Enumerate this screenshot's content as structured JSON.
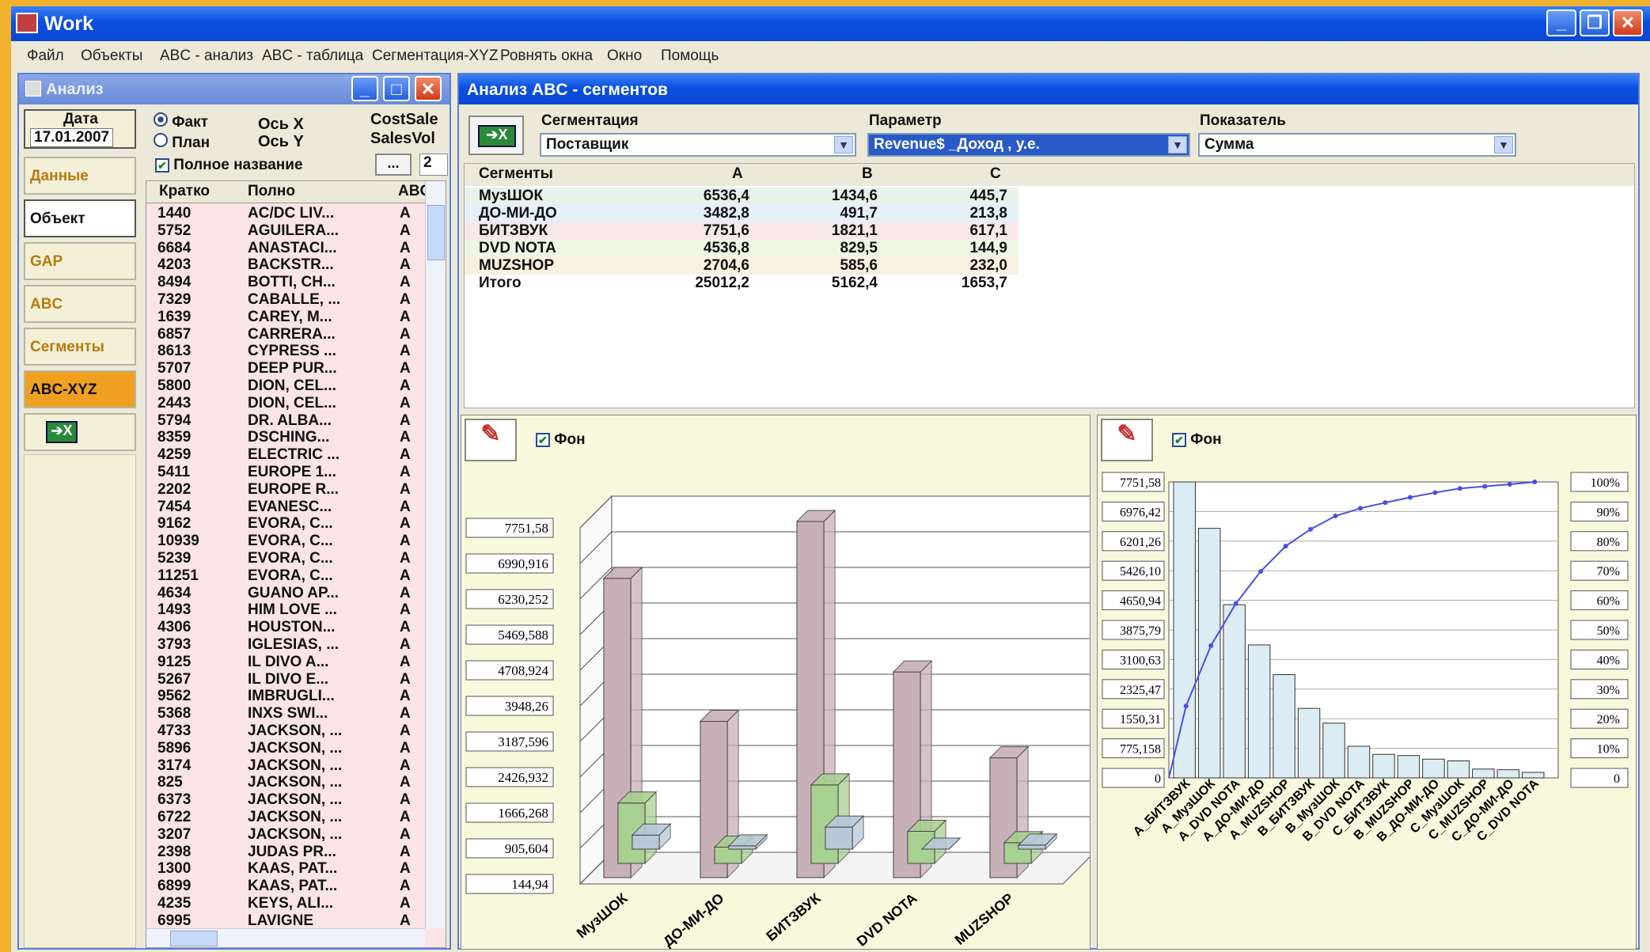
{
  "window": {
    "title": "Work"
  },
  "menu": [
    "Файл",
    "Объекты",
    "ABC - анализ",
    "ABC - таблица",
    "Сегментация-XYZ",
    "Ровнять окна",
    "Окно",
    "Помощь"
  ],
  "left_panel": {
    "title": "Анализ",
    "date_label": "Дата",
    "date_value": "17.01.2007",
    "radio_fact": "Факт",
    "radio_plan": "План",
    "axis_x": "Ось X",
    "axis_y": "Ось Y",
    "full_name": "Полное название",
    "cost_label": "CostSale",
    "sales_label": "SalesVol",
    "ellipsis": "...",
    "num_value": "2",
    "side_buttons": [
      "Данные",
      "Объект",
      "GAP",
      "ABC",
      "Сегменты",
      "ABC-XYZ"
    ],
    "columns": [
      "Кратко",
      "Полно",
      "ABC"
    ],
    "rows": [
      [
        "1440",
        "AC/DC LIV...",
        "A"
      ],
      [
        "5752",
        "AGUILERA...",
        "A"
      ],
      [
        "6684",
        "ANASTACI...",
        "A"
      ],
      [
        "4203",
        "BACKSTR...",
        "A"
      ],
      [
        "8494",
        "BOTTI, CH...",
        "A"
      ],
      [
        "7329",
        "CABALLE, ...",
        "A"
      ],
      [
        "1639",
        "CAREY, M...",
        "A"
      ],
      [
        "6857",
        "CARRERA...",
        "A"
      ],
      [
        "8613",
        "CYPRESS ...",
        "A"
      ],
      [
        "5707",
        "DEEP PUR...",
        "A"
      ],
      [
        "5800",
        "DION, CEL...",
        "A"
      ],
      [
        "2443",
        "DION, CEL...",
        "A"
      ],
      [
        "5794",
        "DR. ALBA...",
        "A"
      ],
      [
        "8359",
        "DSCHING...",
        "A"
      ],
      [
        "4259",
        "ELECTRIC ...",
        "A"
      ],
      [
        "5411",
        "EUROPE 1...",
        "A"
      ],
      [
        "2202",
        "EUROPE R...",
        "A"
      ],
      [
        "7454",
        "EVANESC...",
        "A"
      ],
      [
        "9162",
        "EVORA, C...",
        "A"
      ],
      [
        "10939",
        "EVORA, C...",
        "A"
      ],
      [
        "5239",
        "EVORA, C...",
        "A"
      ],
      [
        "11251",
        "EVORA, C...",
        "A"
      ],
      [
        "4634",
        "GUANO AP...",
        "A"
      ],
      [
        "1493",
        "HIM LOVE ...",
        "A"
      ],
      [
        "4306",
        "HOUSTON...",
        "A"
      ],
      [
        "3793",
        "IGLESIAS, ...",
        "A"
      ],
      [
        "9125",
        "IL DIVO A...",
        "A"
      ],
      [
        "5267",
        "IL DIVO E...",
        "A"
      ],
      [
        "9562",
        "IMBRUGLI...",
        "A"
      ],
      [
        "5368",
        "INXS SWI...",
        "A"
      ],
      [
        "4733",
        "JACKSON, ...",
        "A"
      ],
      [
        "5896",
        "JACKSON, ...",
        "A"
      ],
      [
        "3174",
        "JACKSON, ...",
        "A"
      ],
      [
        "825",
        "JACKSON, ...",
        "A"
      ],
      [
        "6373",
        "JACKSON, ...",
        "A"
      ],
      [
        "6722",
        "JACKSON, ...",
        "A"
      ],
      [
        "3207",
        "JACKSON, ...",
        "A"
      ],
      [
        "2398",
        "JUDAS PR...",
        "A"
      ],
      [
        "1300",
        "KAAS, PAT...",
        "A"
      ],
      [
        "6899",
        "KAAS, PAT...",
        "A"
      ],
      [
        "4235",
        "KEYS, ALI...",
        "A"
      ],
      [
        "6995",
        "LAVIGNE",
        "A"
      ]
    ]
  },
  "main": {
    "title": "Анализ ABC - сегментов",
    "seg_label": "Сегментация",
    "seg_value": "Поставщик",
    "param_label": "Параметр",
    "param_value": "Revenue$ _Доход , у.е.",
    "ind_label": "Показатель",
    "ind_value": "Сумма",
    "table_headers": [
      "Сегменты",
      "A",
      "B",
      "C"
    ],
    "table_rows": [
      [
        "МузШОК",
        "6536,4",
        "1434,6",
        "445,7"
      ],
      [
        "ДО-МИ-ДО",
        "3482,8",
        "491,7",
        "213,8"
      ],
      [
        "БИТЗВУК",
        "7751,6",
        "1821,1",
        "617,1"
      ],
      [
        "DVD NOTA",
        "4536,8",
        "829,5",
        "144,9"
      ],
      [
        "MUZSHOP",
        "2704,6",
        "585,6",
        "232,0"
      ],
      [
        "Итого",
        "25012,2",
        "5162,4",
        "1653,7"
      ]
    ],
    "bg_label": "Фон"
  },
  "chart_data": [
    {
      "type": "bar",
      "categories": [
        "МузШОК",
        "ДО-МИ-ДО",
        "БИТЗВУК",
        "DVD NOTA",
        "MUZSHOP"
      ],
      "series": [
        {
          "values": [
            6536.4,
            3482.8,
            7751.6,
            4536.8,
            2704.6
          ]
        },
        {
          "values": [
            1434.6,
            491.7,
            1821.1,
            829.5,
            585.6
          ]
        },
        {
          "values": [
            445.7,
            213.8,
            617.1,
            144.9,
            232.0
          ]
        }
      ],
      "yticks": [
        "144,94",
        "905,604",
        "1666,268",
        "2426,932",
        "3187,596",
        "3948,26",
        "4708,924",
        "5469,588",
        "6230,252",
        "6990,916",
        "7751,58"
      ],
      "ylim": [
        144.94,
        7751.58
      ],
      "colors": [
        "#c8b0b8",
        "#a8d090",
        "#b8c8d8"
      ]
    },
    {
      "type": "bar",
      "categories": [
        "A_БИТЗВУК",
        "A_МузШОК",
        "A_DVD NOTA",
        "A_ДО-МИ-ДО",
        "A_MUZSHOP",
        "B_БИТЗВУК",
        "B_МузШОК",
        "B_DVD NOTA",
        "C_БИТЗВУК",
        "B_MUZSHOP",
        "B_ДО-МИ-ДО",
        "C_МузШОК",
        "C_MUZSHOP",
        "C_ДО-МИ-ДО",
        "C_DVD NOTA"
      ],
      "values": [
        7751.6,
        6536.4,
        4536.8,
        3482.8,
        2704.6,
        1821.1,
        1434.6,
        829.5,
        617.1,
        585.6,
        491.7,
        445.7,
        232.0,
        213.8,
        144.9
      ],
      "cumulative_pct": [
        24.3,
        44.7,
        58.9,
        69.8,
        78.3,
        84.0,
        88.5,
        91.1,
        93.0,
        94.8,
        96.4,
        97.8,
        98.5,
        99.2,
        100
      ],
      "yticks_left": [
        "0",
        "775,158",
        "1550,31",
        "2325,47",
        "3100,63",
        "3875,79",
        "4650,94",
        "5426,10",
        "6201,26",
        "6976,42",
        "7751,58"
      ],
      "yticks_right": [
        "0",
        "10%",
        "20%",
        "30%",
        "40%",
        "50%",
        "60%",
        "70%",
        "80%",
        "90%",
        "100%"
      ],
      "ylim": [
        0,
        7751.58
      ],
      "colors": {
        "bars": "#dcecf4",
        "line": "#4a50e0"
      }
    }
  ]
}
